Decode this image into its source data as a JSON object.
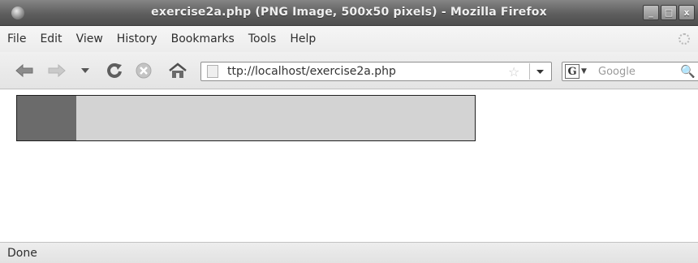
{
  "window": {
    "title": "exercise2a.php (PNG Image, 500x50 pixels) - Mozilla Firefox",
    "controls": {
      "minimize": "_",
      "maximize": "□",
      "close": "x"
    }
  },
  "menubar": {
    "items": [
      {
        "label": "File"
      },
      {
        "label": "Edit"
      },
      {
        "label": "View"
      },
      {
        "label": "History"
      },
      {
        "label": "Bookmarks"
      },
      {
        "label": "Tools"
      },
      {
        "label": "Help"
      }
    ]
  },
  "navbar": {
    "back_icon": "back-arrow-icon",
    "forward_icon": "forward-arrow-icon",
    "history_dropdown_icon": "chevron-down-icon",
    "reload_icon": "reload-icon",
    "stop_icon": "stop-icon",
    "home_icon": "home-icon",
    "url": "ttp://localhost/exercise2a.php",
    "search_engine": "G",
    "search_placeholder": "Google"
  },
  "content": {
    "image": {
      "description_colors": {
        "fill": "#6b6b6b",
        "track": "#d3d3d3",
        "border": "#1f1f1f"
      },
      "fill_fraction": 0.13
    }
  },
  "statusbar": {
    "text": "Done"
  }
}
